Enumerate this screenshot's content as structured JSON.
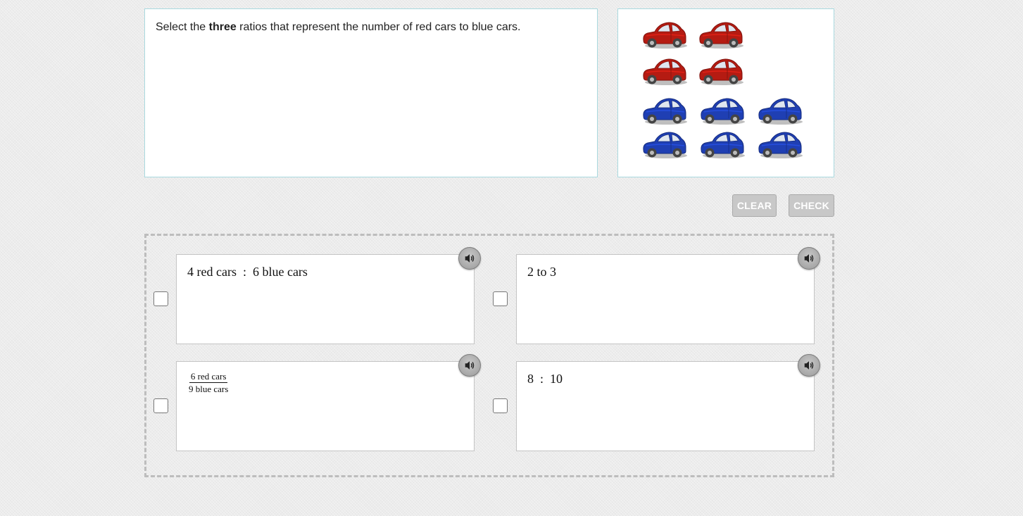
{
  "question": {
    "text_before": "Select the ",
    "text_bold": "three",
    "text_after": " ratios that represent the number of red cars to blue cars."
  },
  "image": {
    "red_cars": 4,
    "blue_cars": 6,
    "red_color": "#b51b12",
    "blue_color": "#1f3fb3"
  },
  "buttons": {
    "clear": "CLEAR",
    "check": "CHECK"
  },
  "choices": [
    {
      "text": "4 red cars  :  6 blue cars"
    },
    {
      "text": "2 to 3"
    },
    {
      "numerator": "6 red cars",
      "denominator": "9 blue cars"
    },
    {
      "text": "8  :  10"
    }
  ],
  "icons": {
    "audio": "speaker-icon",
    "checkbox": "checkbox-icon",
    "car": "car-icon"
  }
}
